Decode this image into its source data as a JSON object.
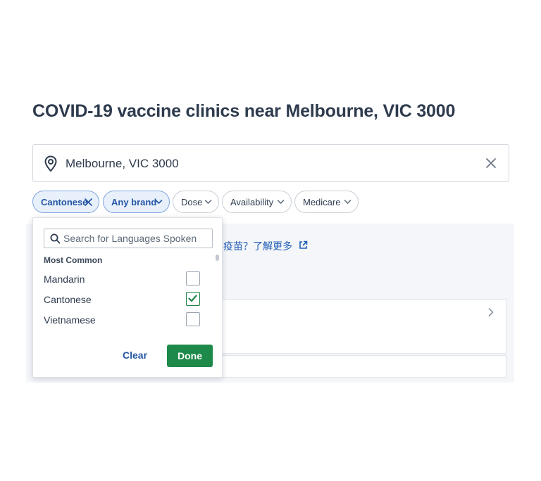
{
  "page": {
    "title": "COVID-19 vaccine clinics near Melbourne, VIC 3000"
  },
  "location": {
    "value": "Melbourne, VIC 3000"
  },
  "filters": {
    "chips": [
      {
        "label": "Cantonese",
        "active": true
      },
      {
        "label": "Any brand",
        "active": true
      },
      {
        "label": "Dose",
        "active": false
      },
      {
        "label": "Availability",
        "active": false
      },
      {
        "label": "Medicare",
        "active": false
      }
    ]
  },
  "results": {
    "banner_text": "疫苗？了解更多"
  },
  "language_dropdown": {
    "search_placeholder": "Search for Languages Spoken",
    "group_label": "Most Common",
    "options": [
      {
        "label": "Mandarin",
        "checked": false
      },
      {
        "label": "Cantonese",
        "checked": true
      },
      {
        "label": "Vietnamese",
        "checked": false
      }
    ],
    "clear_label": "Clear",
    "done_label": "Done"
  },
  "colors": {
    "primary_green": "#1e8a4a",
    "link_blue": "#2456a4",
    "chip_active_bg": "#e8f0fb",
    "heading": "#2e3b4e"
  },
  "icons": {
    "location": "map-pin-icon",
    "clear": "close-icon",
    "chevron": "chevron-down-icon",
    "search": "search-icon",
    "check": "check-icon",
    "external": "external-link-icon"
  }
}
